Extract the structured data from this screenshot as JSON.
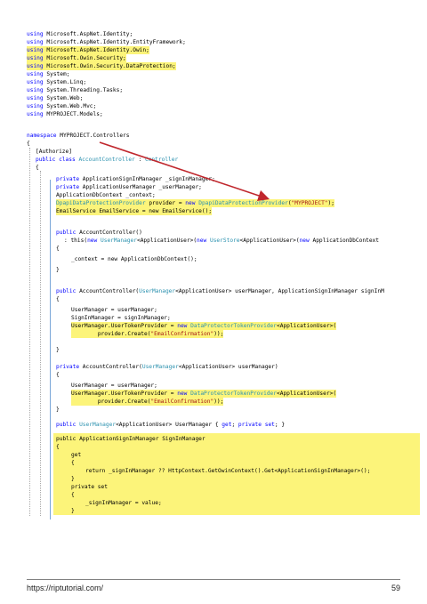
{
  "code": {
    "using": [
      {
        "kw": "using",
        "ns": "Microsoft.AspNet.Identity;"
      },
      {
        "kw": "using",
        "ns": "Microsoft.AspNet.Identity.EntityFramework;"
      },
      {
        "kw": "using",
        "ns": "Microsoft.AspNet.Identity.Owin;"
      },
      {
        "kw": "using",
        "ns": "Microsoft.Owin.Security;"
      },
      {
        "kw": "using",
        "ns": "Microsoft.Owin.Security.DataProtection;"
      },
      {
        "kw": "using",
        "ns": "System;"
      },
      {
        "kw": "using",
        "ns": "System.Linq;"
      },
      {
        "kw": "using",
        "ns": "System.Threading.Tasks;"
      },
      {
        "kw": "using",
        "ns": "System.Web;"
      },
      {
        "kw": "using",
        "ns": "System.Web.Mvc;"
      },
      {
        "kw": "using",
        "ns": "MYPROJECT.Models;"
      }
    ],
    "namespace_kw": "namespace",
    "namespace_name": "MYPROJECT.Controllers",
    "brace_open": "{",
    "brace_close": "}",
    "attr": "[Authorize]",
    "class_kw": "public class",
    "class_name": "AccountController",
    "class_base_sep": " : ",
    "class_base": "Controller",
    "private_kw": "private",
    "public_kw": "public",
    "new_kw": "new",
    "f1": " ApplicationSignInManager _signInManager;",
    "f2": " ApplicationUserManager _userManager;",
    "f3": "ApplicationDbContext _context;",
    "f4_type": "DpapiDataProtectionProvider",
    "f4_mid": " provider = ",
    "f4_type2": "DpapiDataProtectionProvider",
    "f4_str": "\"MYPROJECT\"",
    "f4_end": ");",
    "f5": "EmailService EmailService = new EmailService();",
    "ctor1_name": " AccountController()",
    "ctor1_this_a": ": this(",
    "ctor1_this_b": "UserManager",
    "ctor1_this_c": "<ApplicationUser>(",
    "ctor1_this_d": "UserStore",
    "ctor1_this_e": "<ApplicationUser>(",
    "ctor1_this_f": "ApplicationDbContext",
    "ctor1_body": "_context = new ApplicationDbContext();",
    "ctor2_a": " AccountController(",
    "ctor2_b": "UserManager",
    "ctor2_c": "<ApplicationUser> userManager, ApplicationSignInManager signInM",
    "ctor2_l1": "UserManager = userManager;",
    "ctor2_l2": "SignInManager = signInManager;",
    "utp_a": "UserManager.UserTokenProvider = ",
    "utp_b": "DataProtectorTokenProvider",
    "utp_c": "<ApplicationUser>(",
    "utp_d": "provider.Create(",
    "utp_str": "\"EmailConfirmation\"",
    "utp_e": "));",
    "ctor3_a": " AccountController(",
    "ctor3_b": "UserManager",
    "ctor3_c": "<ApplicationUser> userManager)",
    "prop1_a": " UserManager",
    "prop1_b": "<ApplicationUser> UserManager { ",
    "prop1_get": "get",
    "prop1_mid": "; ",
    "prop1_ps": "private set",
    "prop1_end": "; }",
    "prop2_sig": "public ApplicationSignInManager SignInManager",
    "get_kw": "get",
    "ret_kw": "return",
    "ret_body": " _signInManager ?? HttpContext.GetOwinContext().Get<ApplicationSignInManager>();",
    "private_set": "private set",
    "set_body": "_signInManager = value;"
  },
  "footer": {
    "url": "https://riptutorial.com/",
    "page": "59"
  },
  "colors": {
    "highlight": "#fcf47a",
    "keyword": "#0000ff",
    "type": "#2b91af",
    "string": "#a31515",
    "arrow": "#c0272d"
  }
}
